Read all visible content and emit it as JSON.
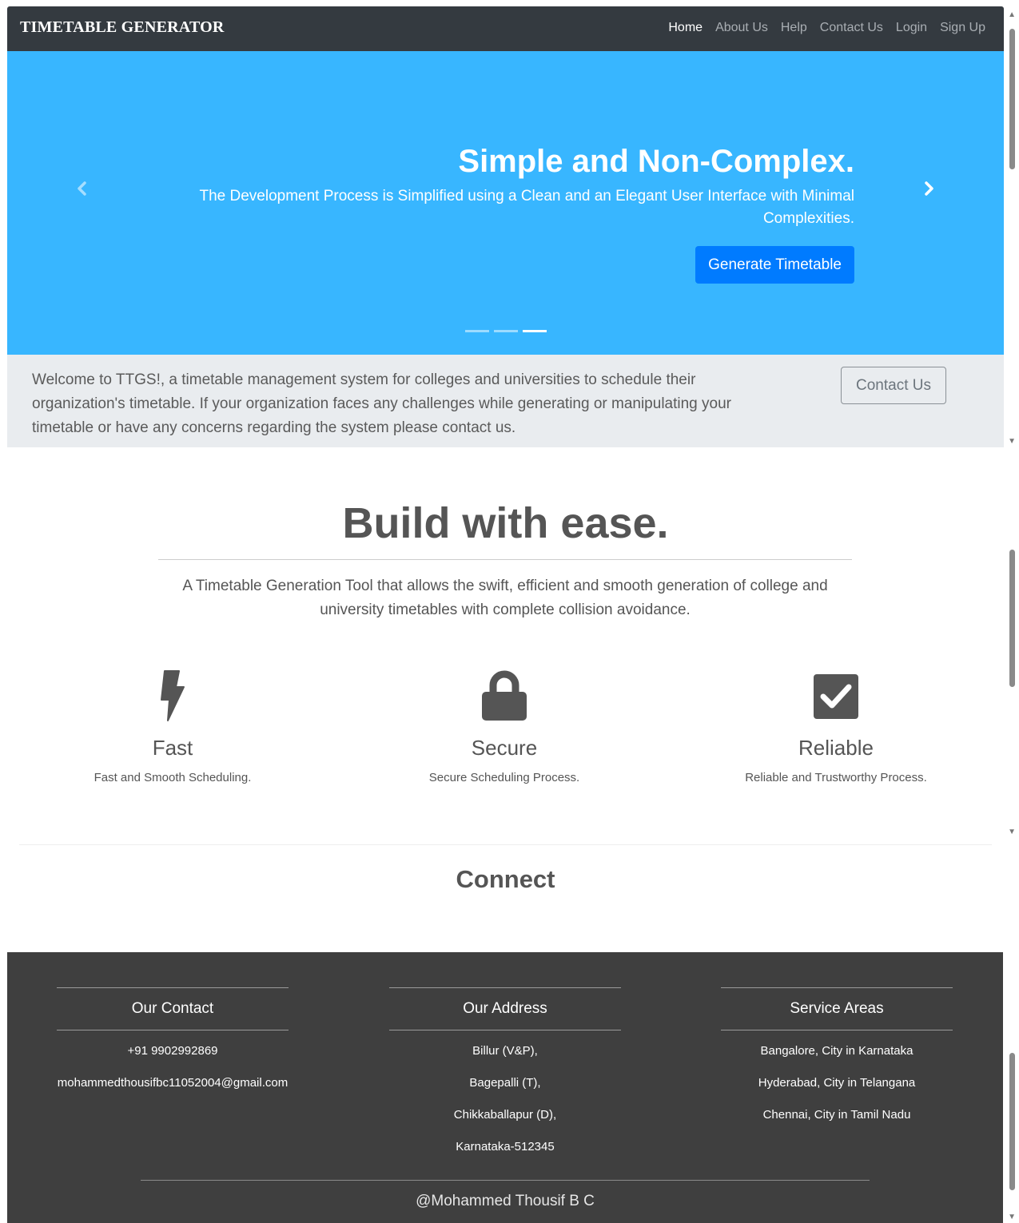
{
  "navbar": {
    "brand": "TIMETABLE GENERATOR",
    "links": [
      "Home",
      "About Us",
      "Help",
      "Contact Us",
      "Login",
      "Sign Up"
    ],
    "active": "Home"
  },
  "carousel": {
    "title": "Simple and Non-Complex.",
    "subtitle": "The Development Process is Simplified using a Clean and an Elegant User Interface with Minimal Complexities.",
    "button": "Generate Timetable",
    "prev_icon": "chevron-left-icon",
    "next_icon": "chevron-right-icon",
    "slides": 3,
    "active_slide": 3,
    "background": "#38b6ff",
    "button_color": "#007bff"
  },
  "welcome": {
    "text": "Welcome to TTGS!, a timetable management system for colleges and universities to schedule their organization's timetable. If your organization faces any challenges while generating or manipulating your timetable or have any concerns regarding the system please contact us.",
    "button": "Contact Us"
  },
  "features": {
    "heading": "Build with ease.",
    "description": "A Timetable Generation Tool that allows the swift, efficient and smooth generation of college and university timetables with complete collision avoidance.",
    "items": [
      {
        "icon": "lightning-bolt-icon",
        "title": "Fast",
        "text": "Fast and Smooth Scheduling."
      },
      {
        "icon": "lock-icon",
        "title": "Secure",
        "text": "Secure Scheduling Process."
      },
      {
        "icon": "checkbox-checked-icon",
        "title": "Reliable",
        "text": "Reliable and Trustworthy Process."
      }
    ]
  },
  "connect": {
    "heading": "Connect"
  },
  "footer": {
    "columns": [
      {
        "heading": "Our Contact",
        "items": [
          "+91 9902992869",
          "mohammedthousifbc11052004@gmail.com"
        ]
      },
      {
        "heading": "Our Address",
        "items": [
          "Billur (V&P),",
          "Bagepalli (T),",
          "Chikkaballapur (D),",
          "Karnataka-512345"
        ]
      },
      {
        "heading": "Service Areas",
        "items": [
          "Bangalore, City in Karnataka",
          "Hyderabad, City in Telangana",
          "Chennai, City in Tamil Nadu"
        ]
      }
    ],
    "credit": "@Mohammed Thousif B C",
    "background": "#3f3f3f"
  }
}
